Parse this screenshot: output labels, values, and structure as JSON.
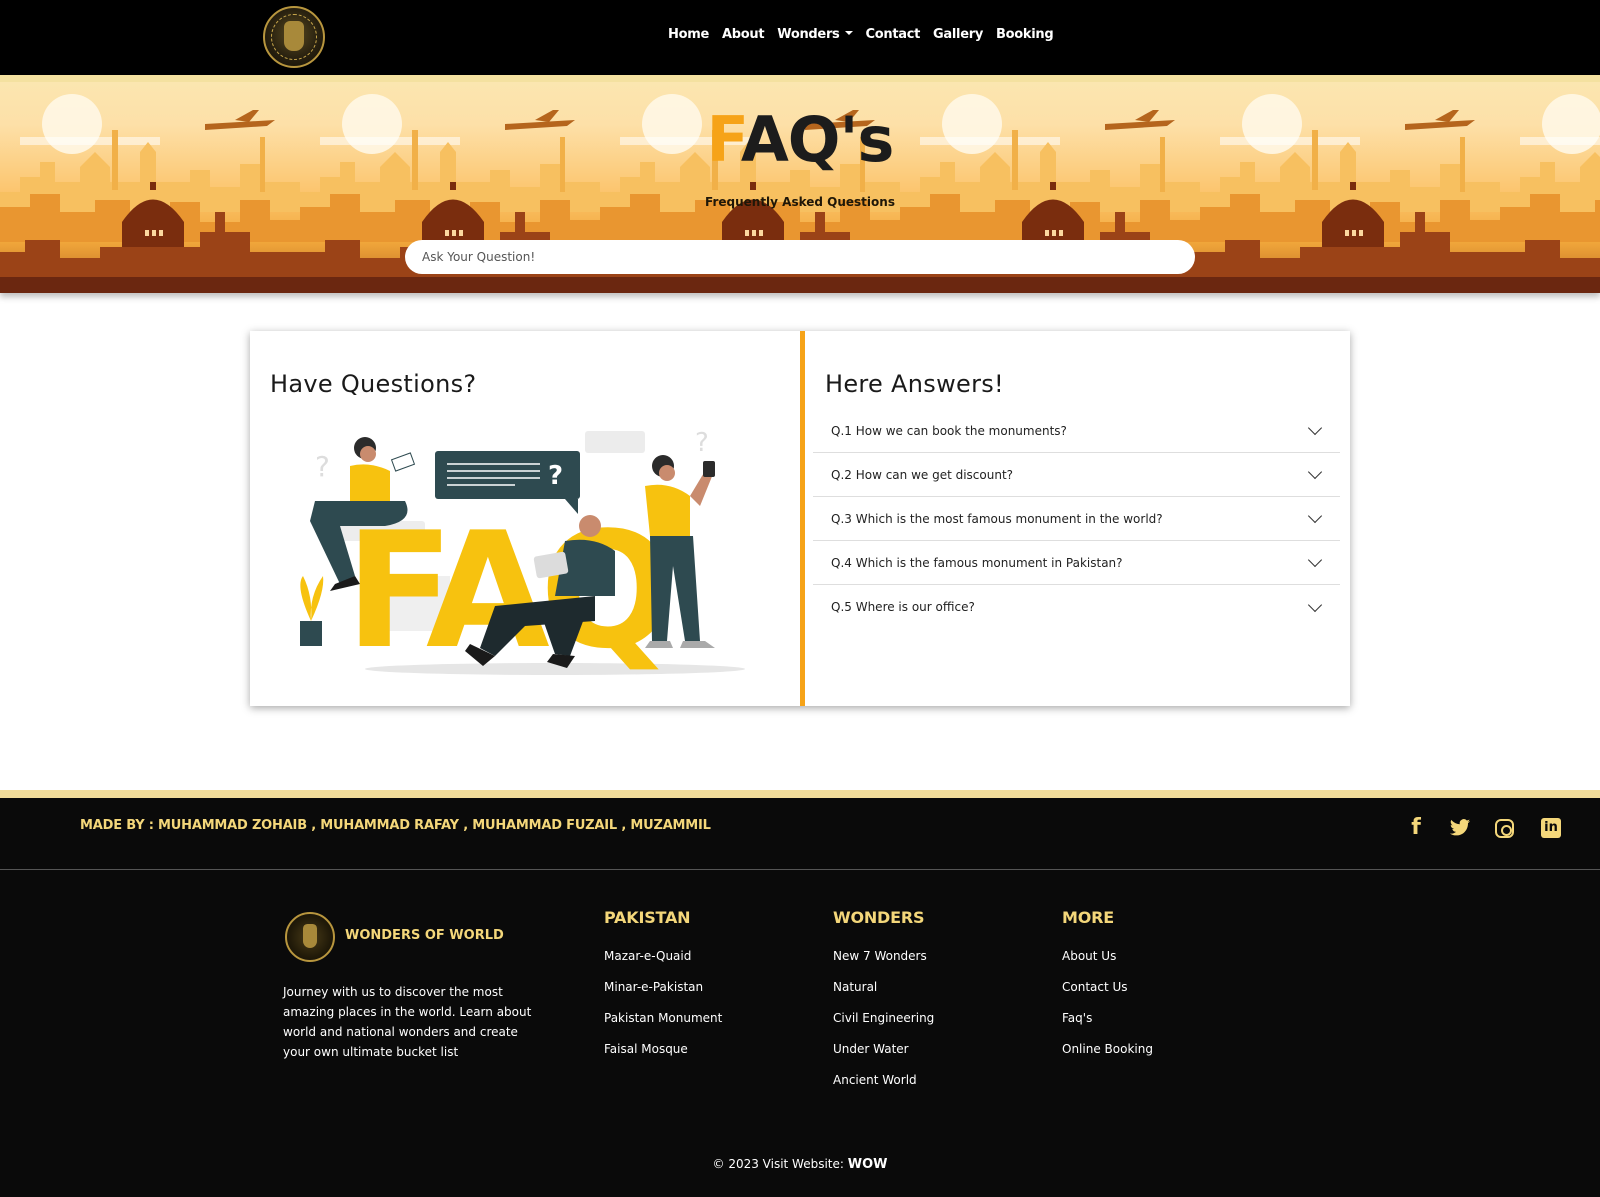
{
  "nav": {
    "items": [
      "Home",
      "About",
      "Wonders",
      "Contact",
      "Gallery",
      "Booking"
    ]
  },
  "hero": {
    "title_first": "F",
    "title_rest": "AQ's",
    "subtitle": "Frequently Asked Questions",
    "search_placeholder": "Ask Your Question!"
  },
  "left_panel": {
    "heading": "Have Questions?"
  },
  "right_panel": {
    "heading": "Here Answers!",
    "questions": [
      "Q.1 How we can book the monuments?",
      "Q.2 How can we get discount?",
      "Q.3 Which is the most famous monument in the world?",
      "Q.4 Which is the famous monument in Pakistan?",
      "Q.5 Where is our office?"
    ]
  },
  "footer": {
    "made_by": "MADE BY : MUHAMMAD ZOHAIB , MUHAMMAD RAFAY , MUHAMMAD FUZAIL , MUZAMMIL",
    "brand": "WONDERS OF WORLD",
    "description": "Journey with us to discover the most amazing places in the world. Learn about world and national wonders and create your own ultimate bucket list",
    "columns": [
      {
        "title": "PAKISTAN",
        "links": [
          "Mazar-e-Quaid",
          "Minar-e-Pakistan",
          "Pakistan Monument",
          "Faisal Mosque"
        ]
      },
      {
        "title": "WONDERS",
        "links": [
          "New 7 Wonders",
          "Natural",
          "Civil Engineering",
          "Under Water",
          "Ancient World"
        ]
      },
      {
        "title": "MORE",
        "links": [
          "About Us",
          "Contact Us",
          "Faq's",
          "Online Booking"
        ]
      }
    ],
    "copyright_prefix": "© 2023 Visit Website:",
    "copyright_brand": "WOW",
    "social_icons": [
      "facebook-icon",
      "twitter-icon",
      "instagram-icon",
      "linkedin-icon"
    ]
  },
  "colors": {
    "accent": "#f6a318",
    "gold": "#f4d77a",
    "footer_bg": "#0a0a0a"
  }
}
